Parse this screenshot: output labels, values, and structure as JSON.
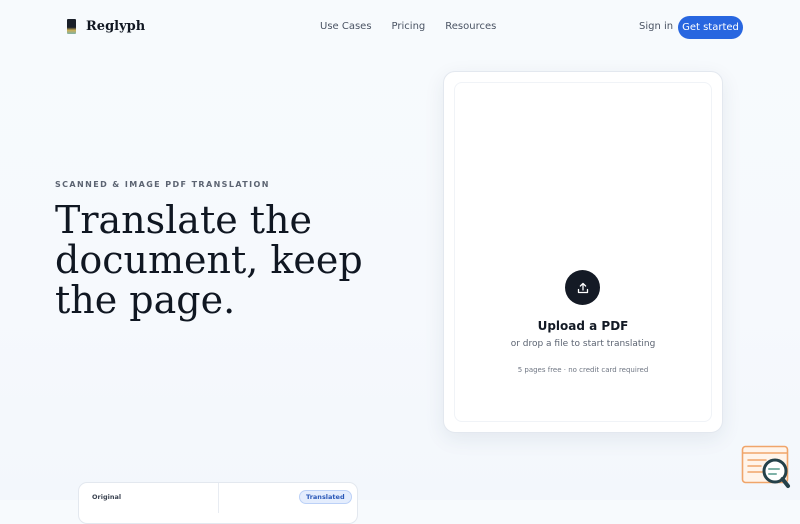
{
  "header": {
    "brand": "Reglyph",
    "nav": [
      "Use Cases",
      "Pricing",
      "Resources"
    ],
    "signin": "Sign in",
    "cta": "Get started"
  },
  "hero": {
    "eyebrow": "SCANNED & IMAGE PDF TRANSLATION",
    "headline": [
      "Translate the",
      "document, keep",
      "the page."
    ]
  },
  "upload": {
    "title": "Upload a PDF",
    "subtitle": "or drop a file to start translating",
    "note": "5 pages free · no credit card required",
    "icon": "upload-icon"
  },
  "preview": {
    "original_label": "Original",
    "translated_badge": "Translated"
  },
  "colors": {
    "accent": "#2866e0",
    "ink": "#141a25",
    "widget": "#f0a56a"
  },
  "widget": {
    "icon": "chat-search-icon"
  }
}
